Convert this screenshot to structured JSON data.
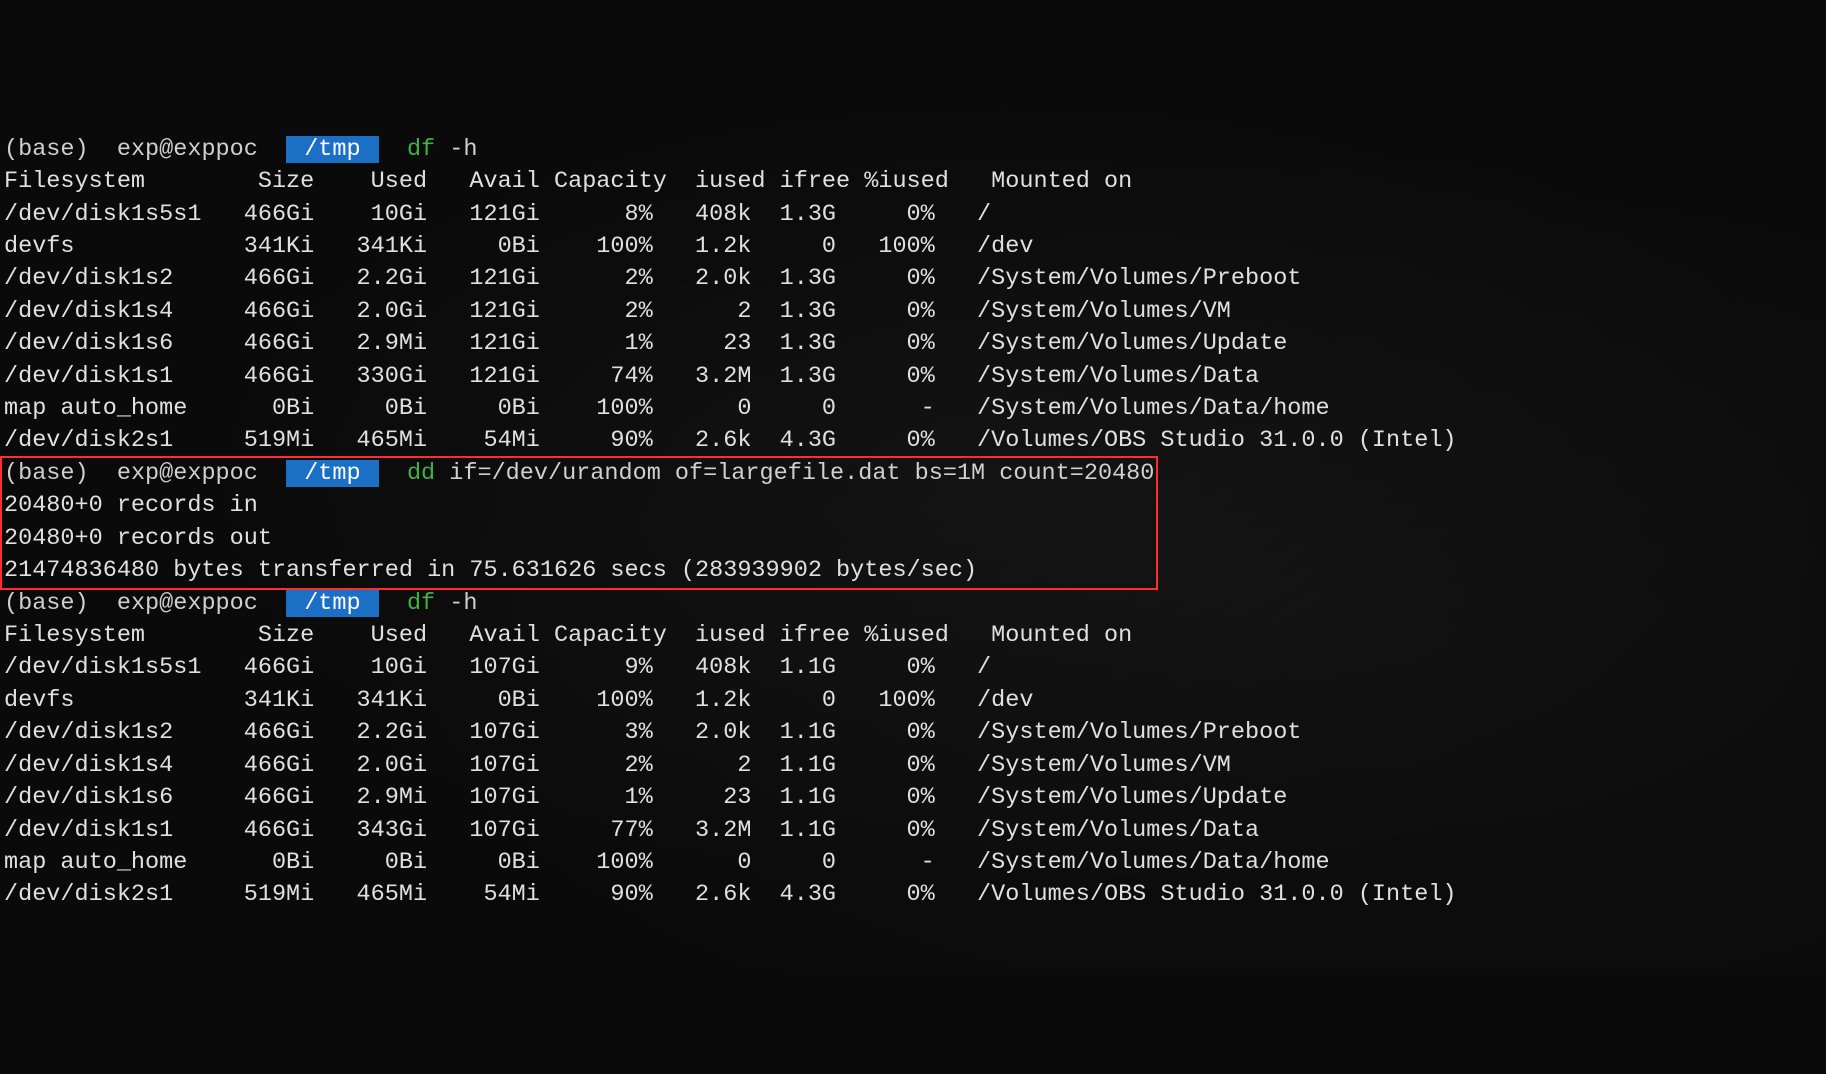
{
  "prompt": {
    "env": "(base)",
    "user": "exp@exppoc",
    "path": "/tmp"
  },
  "cmd1": {
    "name": "df",
    "args": "-h"
  },
  "df1": {
    "header": {
      "fs": "Filesystem",
      "size": "Size",
      "used": "Used",
      "avail": "Avail",
      "cap": "Capacity",
      "iused": "iused",
      "ifree": "ifree",
      "piu": "%iused",
      "mnt": "Mounted on"
    },
    "rows": [
      {
        "fs": "/dev/disk1s5s1",
        "size": "466Gi",
        "used": "10Gi",
        "avail": "121Gi",
        "cap": "8%",
        "iused": "408k",
        "ifree": "1.3G",
        "piu": "0%",
        "mnt": "/"
      },
      {
        "fs": "devfs",
        "size": "341Ki",
        "used": "341Ki",
        "avail": "0Bi",
        "cap": "100%",
        "iused": "1.2k",
        "ifree": "0",
        "piu": "100%",
        "mnt": "/dev"
      },
      {
        "fs": "/dev/disk1s2",
        "size": "466Gi",
        "used": "2.2Gi",
        "avail": "121Gi",
        "cap": "2%",
        "iused": "2.0k",
        "ifree": "1.3G",
        "piu": "0%",
        "mnt": "/System/Volumes/Preboot"
      },
      {
        "fs": "/dev/disk1s4",
        "size": "466Gi",
        "used": "2.0Gi",
        "avail": "121Gi",
        "cap": "2%",
        "iused": "2",
        "ifree": "1.3G",
        "piu": "0%",
        "mnt": "/System/Volumes/VM"
      },
      {
        "fs": "/dev/disk1s6",
        "size": "466Gi",
        "used": "2.9Mi",
        "avail": "121Gi",
        "cap": "1%",
        "iused": "23",
        "ifree": "1.3G",
        "piu": "0%",
        "mnt": "/System/Volumes/Update"
      },
      {
        "fs": "/dev/disk1s1",
        "size": "466Gi",
        "used": "330Gi",
        "avail": "121Gi",
        "cap": "74%",
        "iused": "3.2M",
        "ifree": "1.3G",
        "piu": "0%",
        "mnt": "/System/Volumes/Data"
      },
      {
        "fs": "map auto_home",
        "size": "0Bi",
        "used": "0Bi",
        "avail": "0Bi",
        "cap": "100%",
        "iused": "0",
        "ifree": "0",
        "piu": "-",
        "mnt": "/System/Volumes/Data/home"
      },
      {
        "fs": "/dev/disk2s1",
        "size": "519Mi",
        "used": "465Mi",
        "avail": "54Mi",
        "cap": "90%",
        "iused": "2.6k",
        "ifree": "4.3G",
        "piu": "0%",
        "mnt": "/Volumes/OBS Studio 31.0.0 (Intel)"
      }
    ]
  },
  "cmd2": {
    "name": "dd",
    "args": "if=/dev/urandom of=largefile.dat bs=1M count=20480"
  },
  "dd_out": {
    "l1": "20480+0 records in",
    "l2": "20480+0 records out",
    "l3": "21474836480 bytes transferred in 75.631626 secs (283939902 bytes/sec)"
  },
  "cmd3": {
    "name": "df",
    "args": "-h"
  },
  "df2": {
    "header": {
      "fs": "Filesystem",
      "size": "Size",
      "used": "Used",
      "avail": "Avail",
      "cap": "Capacity",
      "iused": "iused",
      "ifree": "ifree",
      "piu": "%iused",
      "mnt": "Mounted on"
    },
    "rows": [
      {
        "fs": "/dev/disk1s5s1",
        "size": "466Gi",
        "used": "10Gi",
        "avail": "107Gi",
        "cap": "9%",
        "iused": "408k",
        "ifree": "1.1G",
        "piu": "0%",
        "mnt": "/"
      },
      {
        "fs": "devfs",
        "size": "341Ki",
        "used": "341Ki",
        "avail": "0Bi",
        "cap": "100%",
        "iused": "1.2k",
        "ifree": "0",
        "piu": "100%",
        "mnt": "/dev"
      },
      {
        "fs": "/dev/disk1s2",
        "size": "466Gi",
        "used": "2.2Gi",
        "avail": "107Gi",
        "cap": "3%",
        "iused": "2.0k",
        "ifree": "1.1G",
        "piu": "0%",
        "mnt": "/System/Volumes/Preboot"
      },
      {
        "fs": "/dev/disk1s4",
        "size": "466Gi",
        "used": "2.0Gi",
        "avail": "107Gi",
        "cap": "2%",
        "iused": "2",
        "ifree": "1.1G",
        "piu": "0%",
        "mnt": "/System/Volumes/VM"
      },
      {
        "fs": "/dev/disk1s6",
        "size": "466Gi",
        "used": "2.9Mi",
        "avail": "107Gi",
        "cap": "1%",
        "iused": "23",
        "ifree": "1.1G",
        "piu": "0%",
        "mnt": "/System/Volumes/Update"
      },
      {
        "fs": "/dev/disk1s1",
        "size": "466Gi",
        "used": "343Gi",
        "avail": "107Gi",
        "cap": "77%",
        "iused": "3.2M",
        "ifree": "1.1G",
        "piu": "0%",
        "mnt": "/System/Volumes/Data"
      },
      {
        "fs": "map auto_home",
        "size": "0Bi",
        "used": "0Bi",
        "avail": "0Bi",
        "cap": "100%",
        "iused": "0",
        "ifree": "0",
        "piu": "-",
        "mnt": "/System/Volumes/Data/home"
      },
      {
        "fs": "/dev/disk2s1",
        "size": "519Mi",
        "used": "465Mi",
        "avail": "54Mi",
        "cap": "90%",
        "iused": "2.6k",
        "ifree": "4.3G",
        "piu": "0%",
        "mnt": "/Volumes/OBS Studio 31.0.0 (Intel)"
      }
    ]
  },
  "widths": {
    "fs": 14,
    "size": 8,
    "used": 8,
    "avail": 8,
    "cap": 9,
    "iused": 6,
    "ifree": 6,
    "piu": 7
  }
}
